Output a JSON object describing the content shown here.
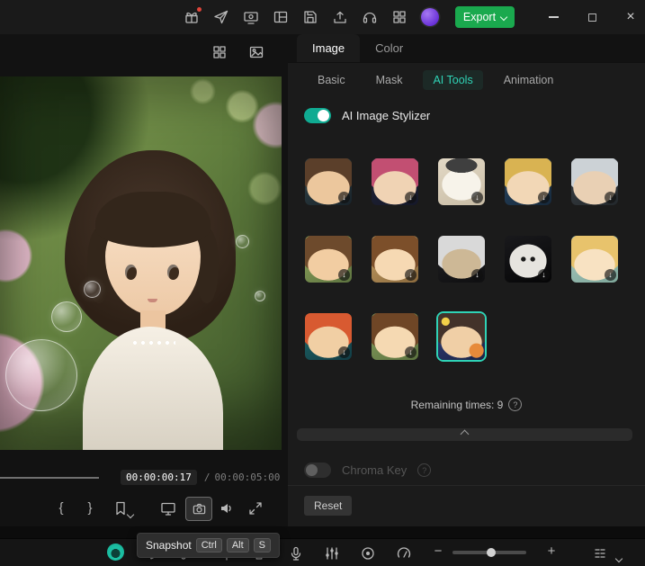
{
  "titlebar": {
    "export_label": "Export"
  },
  "preview": {
    "time_current": "00:00:00:17",
    "time_sep": "/",
    "time_total": "00:00:05:00",
    "tooltip": {
      "label": "Snapshot",
      "keys": [
        "Ctrl",
        "Alt",
        "S"
      ]
    }
  },
  "panel": {
    "tabs": [
      {
        "label": "Image"
      },
      {
        "label": "Color"
      }
    ],
    "subtabs": [
      {
        "label": "Basic"
      },
      {
        "label": "Mask"
      },
      {
        "label": "AI Tools"
      },
      {
        "label": "Animation"
      }
    ],
    "stylizer_label": "AI Image Stylizer",
    "remaining_label": "Remaining times: 9",
    "chroma_label": "Chroma Key",
    "reset_label": "Reset",
    "thumbs": [
      {
        "name": "anime-boy-brown",
        "css": "background: radial-gradient(ellipse 46% 36% at 50% 63%, #ecc79d 98%, transparent), radial-gradient(ellipse 60% 46% at 50% 33%, #5b3f2a 98%, transparent), linear-gradient(150deg, #35464a, #18232a)"
      },
      {
        "name": "anime-boy-pink",
        "css": "background: radial-gradient(ellipse 46% 36% at 50% 63%, #f0d3b4 98%, transparent), radial-gradient(ellipse 60% 46% at 50% 33%, #c24f72 98%, transparent), linear-gradient(150deg, #232637, #15182a)"
      },
      {
        "name": "clay-figure",
        "css": "background: radial-gradient(ellipse 34% 16% at 50% 15%, #3f3f3f 98%, transparent), radial-gradient(ellipse 42% 34% at 50% 56%, #f7f3ea 98%, transparent), linear-gradient(160deg, #e3d9c6, #c9bda6)"
      },
      {
        "name": "anime-boy-blond",
        "css": "background: radial-gradient(ellipse 46% 36% at 50% 63%, #f2d7b6 98%, transparent), radial-gradient(ellipse 60% 46% at 50% 33%, #d9b352 98%, transparent), linear-gradient(150deg, #2c4a66, #16293c)"
      },
      {
        "name": "anime-boy-silver",
        "css": "background: radial-gradient(ellipse 46% 36% at 50% 63%, #e9d0b4 98%, transparent), radial-gradient(ellipse 60% 46% at 50% 33%, #ccd2d6 98%, transparent), linear-gradient(150deg, #3e4449, #23282c)"
      },
      {
        "name": "portrait-girl",
        "css": "background: radial-gradient(ellipse 44% 34% at 50% 62%, #f2cda2 98%, transparent), radial-gradient(ellipse 62% 48% at 50% 36%, #6d4a2c 98%, transparent), linear-gradient(150deg, #93a95e, #5d7340)"
      },
      {
        "name": "anime-girl-warm",
        "css": "background: radial-gradient(ellipse 44% 34% at 50% 62%, #f6d9b3 98%, transparent), radial-gradient(ellipse 62% 48% at 50% 36%, #7c4f2a 98%, transparent), linear-gradient(150deg, #c9a368, #8c6b3e)"
      },
      {
        "name": "dark-witch",
        "css": "background: radial-gradient(ellipse 42% 32% at 50% 60%, #cdb896 98%, transparent), radial-gradient(ellipse 62% 48% at 50% 34%, #d9d9d9 98%, transparent), linear-gradient(160deg, #232325, #0f0f11)"
      },
      {
        "name": "ghost-face",
        "css": "background: radial-gradient(circle at 40% 50%, #1a1a1a 0 6%, transparent 7%), radial-gradient(circle at 60% 50%, #1a1a1a 0 6%, transparent 7%), radial-gradient(ellipse 40% 36% at 50% 54%, #e6e4df 98%, transparent), linear-gradient(160deg, #19191c, #060607)"
      },
      {
        "name": "flower-girl-blonde",
        "css": "background: radial-gradient(ellipse 44% 34% at 50% 62%, #f8e2c2 98%, transparent), radial-gradient(ellipse 62% 48% at 50% 36%, #e8c36c 98%, transparent), linear-gradient(150deg, #a9c8bf, #7fa89b)"
      },
      {
        "name": "flame-hair-boy",
        "css": "background: radial-gradient(ellipse 44% 34% at 50% 62%, #f1cfa4 98%, transparent), radial-gradient(ellipse 62% 48% at 50% 34%, #d85a31 98%, transparent), linear-gradient(150deg, #1f6b6b, #123d46)"
      },
      {
        "name": "forest-girl",
        "css": "background: radial-gradient(ellipse 44% 34% at 50% 62%, #f5d9b2 98%, transparent), radial-gradient(ellipse 62% 48% at 50% 36%, #6f4626 98%, transparent), linear-gradient(150deg, #8aa061, #5c7440)"
      },
      {
        "name": "star-girl-selected",
        "css": "background: radial-gradient(circle at 82% 80%, #e78a3a 0 13%, transparent 14%), radial-gradient(circle at 16% 18%, #f2d049 0 7%, transparent 8%), radial-gradient(ellipse 44% 34% at 50% 62%, #f0cfa6 98%, transparent), radial-gradient(ellipse 62% 48% at 50% 33%, #43322a 98%, transparent), linear-gradient(150deg, #33427c, #1b2347)"
      }
    ]
  },
  "icons": {
    "brace_open": "{",
    "brace_close": "}",
    "minus": "−",
    "plus": "+",
    "close": "×",
    "download": "↓",
    "info": "?"
  },
  "colors": {
    "accent_teal": "#2fd3b6",
    "export_green": "#1aa94e"
  }
}
